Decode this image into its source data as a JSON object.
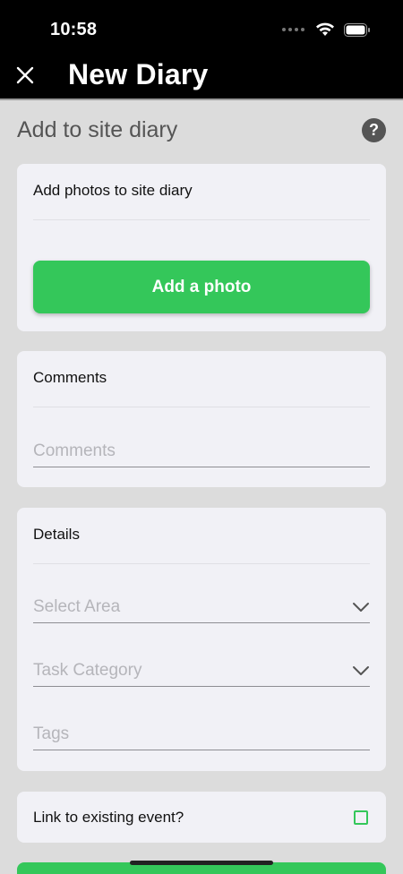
{
  "status_bar": {
    "time": "10:58"
  },
  "nav": {
    "title": "New Diary"
  },
  "page": {
    "title": "Add to site diary"
  },
  "photos_card": {
    "label": "Add photos to site diary",
    "button_label": "Add a photo"
  },
  "comments_card": {
    "label": "Comments",
    "placeholder": "Comments"
  },
  "details_card": {
    "label": "Details",
    "area_placeholder": "Select Area",
    "category_placeholder": "Task Category",
    "tags_placeholder": "Tags"
  },
  "link_card": {
    "label": "Link to existing event?",
    "checked": false
  },
  "colors": {
    "accent": "#34c75a",
    "header_bg": "#000000",
    "page_bg": "#dcdcdc",
    "card_bg": "#f1f1f6"
  },
  "icons": [
    "wifi-icon",
    "battery-icon",
    "close-icon",
    "help-icon",
    "chevron-down-icon"
  ]
}
